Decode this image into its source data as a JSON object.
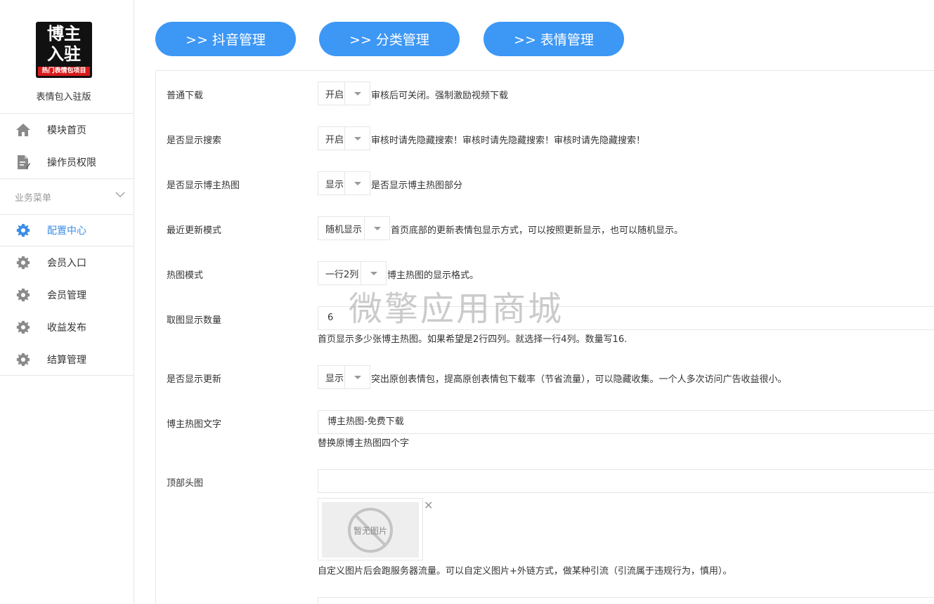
{
  "brand": {
    "logo_line1": "博主",
    "logo_line2": "入驻",
    "logo_band": "热门表情包项目",
    "name": "表情包入驻版"
  },
  "sidebar": {
    "top_items": [
      {
        "label": "模块首页",
        "icon": "home-icon"
      },
      {
        "label": "操作员权限",
        "icon": "document-edit-icon"
      }
    ],
    "group_title": "业务菜单",
    "items": [
      {
        "label": "配置中心",
        "icon": "gear-icon",
        "active": true
      },
      {
        "label": "会员入口",
        "icon": "gear-icon"
      },
      {
        "label": "会员管理",
        "icon": "gear-icon"
      },
      {
        "label": "收益发布",
        "icon": "gear-icon"
      },
      {
        "label": "结算管理",
        "icon": "gear-icon"
      }
    ]
  },
  "top_buttons": [
    {
      "label": ">> 抖音管理"
    },
    {
      "label": ">> 分类管理"
    },
    {
      "label": ">> 表情管理"
    }
  ],
  "form": {
    "normal_download": {
      "label": "普通下载",
      "value": "开启",
      "help": "审核后可关闭。强制激励视频下载"
    },
    "show_search": {
      "label": "是否显示搜索",
      "value": "开启",
      "help": "审核时请先隐藏搜索！审核时请先隐藏搜索！审核时请先隐藏搜索！"
    },
    "show_hot": {
      "label": "是否显示博主热图",
      "value": "显示",
      "help": "是否显示博主热图部分"
    },
    "recent_mode": {
      "label": "最近更新模式",
      "value": "随机显示",
      "help": "首页底部的更新表情包显示方式，可以按照更新显示，也可以随机显示。"
    },
    "hot_mode": {
      "label": "热图模式",
      "value": "一行2列",
      "help": "博主热图的显示格式。"
    },
    "hot_count": {
      "label": "取图显示数量",
      "value": "6",
      "help": "首页显示多少张博主热图。如果希望是2行四列。就选择一行4列。数量写16."
    },
    "show_update": {
      "label": "是否显示更新",
      "value": "显示",
      "help": "突出原创表情包，提高原创表情包下载率（节省流量），可以隐藏收集。一个人多次访问广告收益很小。"
    },
    "hot_text": {
      "label": "博主热图文字",
      "value": "博主热图-免费下载",
      "help": "替换原博主热图四个字"
    },
    "top_image": {
      "label": "顶部头图",
      "value": "",
      "placeholder_text": "暂无图片",
      "help": "自定义图片后会跑服务器流量。可以自定义图片+外链方式，做某种引流（引流属于违规行为，慎用）。"
    }
  },
  "watermark": "微擎应用商城",
  "colors": {
    "accent": "#3d97f5",
    "active_text": "#3a8ee6",
    "border": "#e6e6e6"
  }
}
